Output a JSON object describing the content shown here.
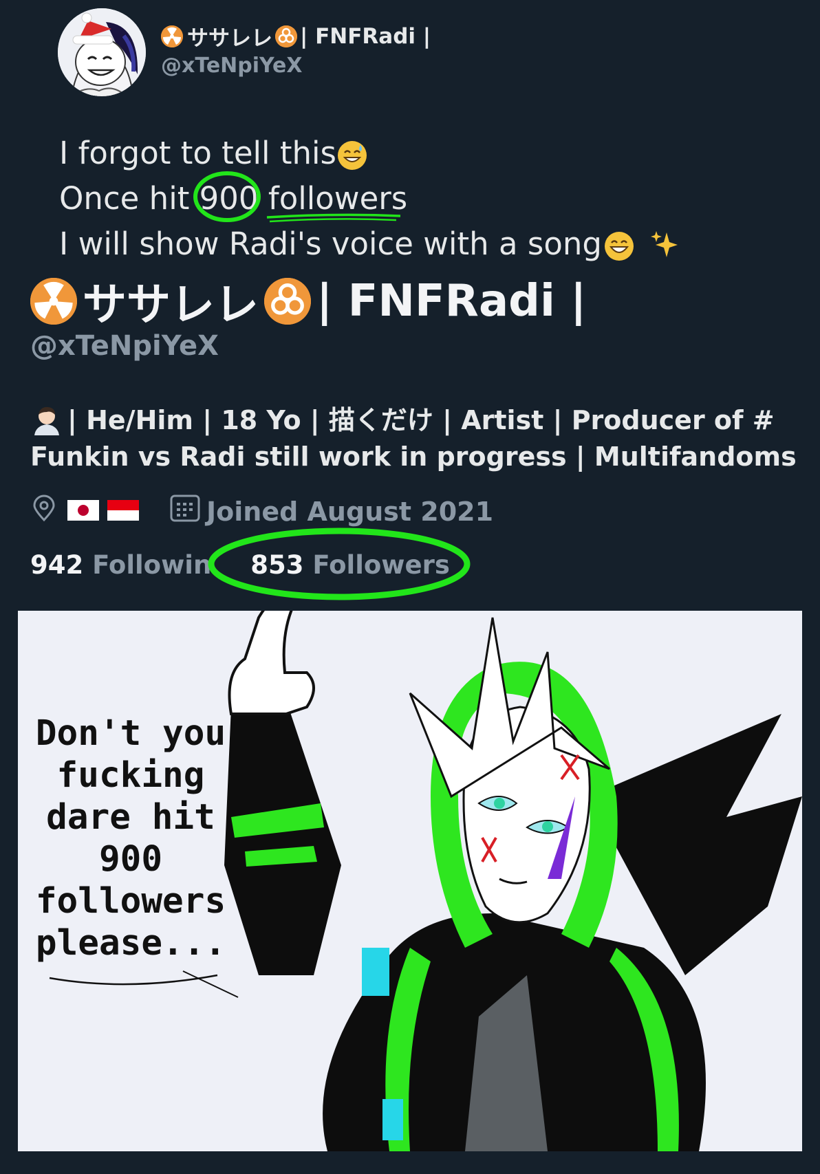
{
  "tweet": {
    "display_name": "ササレレ",
    "display_name_suffix": "| FNFRadi |",
    "handle": "@xTeNpiYeX",
    "line1": "I forgot to tell this",
    "line2_pre": "Once hit",
    "line2_num": "900",
    "line2_post": "followers",
    "line3": "I will show Radi's voice with a song"
  },
  "profile": {
    "display_name": "ササレレ",
    "display_name_suffix": "| FNFRadi |",
    "handle": "@xTeNpiYeX",
    "bio_line1": "| He/Him | 18 Yo | 描くだけ | Artist | Producer of #",
    "bio_line2": "Funkin vs Radi still work in progress | Multifandoms",
    "joined": "Joined August 2021",
    "following_count": "942",
    "following_label": "Followin",
    "followers_count": "853",
    "followers_label": "Followers"
  },
  "comic": {
    "caption_lines": [
      "Don't you",
      "fucking",
      "dare hit",
      "900",
      "followers",
      "please..."
    ]
  },
  "colors": {
    "background": "#15202b",
    "highlight": "#22e51a",
    "text_primary": "#e7e9ea",
    "text_secondary": "#8b98a5",
    "hazard_orange": "#f0973a"
  },
  "icons": {
    "radioactive": "radioactive-icon",
    "biohazard": "biohazard-icon",
    "sweat_smile": "sweat-smile-emoji",
    "grin": "grin-emoji",
    "sparkles": "sparkles-emoji",
    "location": "location-icon",
    "calendar": "calendar-icon"
  }
}
